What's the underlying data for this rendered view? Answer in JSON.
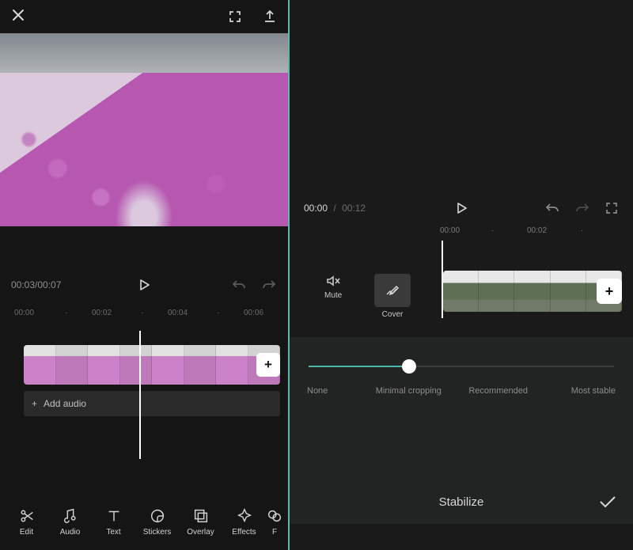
{
  "left": {
    "time": "00:03/00:07",
    "ticks": [
      "00:00",
      "00:02",
      "00:04",
      "00:06"
    ],
    "add_audio": "Add audio",
    "nav": [
      {
        "label": "Edit"
      },
      {
        "label": "Audio"
      },
      {
        "label": "Text"
      },
      {
        "label": "Stickers"
      },
      {
        "label": "Overlay"
      },
      {
        "label": "Effects"
      }
    ]
  },
  "right": {
    "time_current": "00:00",
    "time_sep": "/",
    "time_duration": "00:12",
    "ticks": [
      "00:00",
      "00:02"
    ],
    "mute": "Mute",
    "cover": "Cover",
    "slider": {
      "labels": [
        "None",
        "Minimal cropping",
        "Recommended",
        "Most stable"
      ],
      "selected_index": 1
    },
    "panel_title": "Stabilize"
  }
}
